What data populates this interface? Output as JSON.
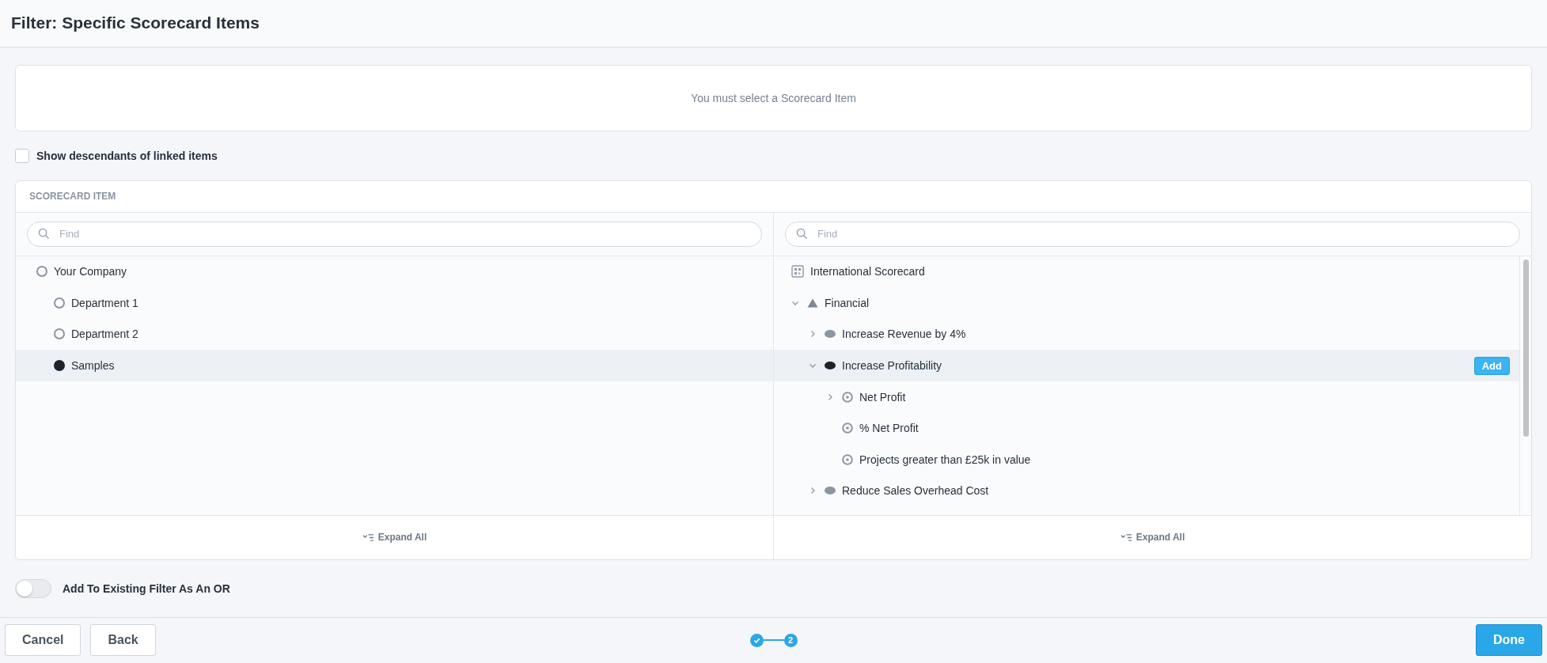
{
  "header": {
    "title": "Filter: Specific Scorecard Items"
  },
  "message": "You must select a Scorecard Item",
  "descendants_option": {
    "label": "Show descendants of linked items",
    "checked": false
  },
  "panel": {
    "heading": "SCORECARD ITEM",
    "left": {
      "search": {
        "placeholder": "Find"
      },
      "items": [
        {
          "label": "Your Company",
          "selected": false,
          "children": [
            {
              "label": "Department 1",
              "selected": false
            },
            {
              "label": "Department 2",
              "selected": false
            },
            {
              "label": "Samples",
              "selected": true
            }
          ]
        }
      ],
      "footer": "Expand All"
    },
    "right": {
      "search": {
        "placeholder": "Find"
      },
      "root": {
        "label": "International Scorecard"
      },
      "items": [
        {
          "label": "Financial",
          "kind": "perspective",
          "expanded": true,
          "selected": false,
          "children": [
            {
              "label": "Increase Revenue by 4%",
              "kind": "objective",
              "expanded": false,
              "selected": false
            },
            {
              "label": "Increase Profitability",
              "kind": "objective",
              "expanded": true,
              "selected": true,
              "action": "Add",
              "children": [
                {
                  "label": "Net Profit",
                  "kind": "measure",
                  "expanded": false,
                  "selected": false
                },
                {
                  "label": "% Net Profit",
                  "kind": "measure",
                  "selected": false
                },
                {
                  "label": "Projects greater than £25k in value",
                  "kind": "measure",
                  "selected": false
                }
              ]
            },
            {
              "label": "Reduce Sales Overhead Cost",
              "kind": "objective",
              "expanded": false,
              "selected": false
            }
          ]
        }
      ],
      "footer": "Expand All"
    }
  },
  "or_option": {
    "label": "Add To Existing Filter As An OR",
    "on": false
  },
  "footer": {
    "buttons": [
      "Cancel",
      "Back"
    ],
    "steps": [
      {
        "done": true
      },
      {
        "done": false,
        "label": "2"
      }
    ],
    "primary": "Done"
  }
}
